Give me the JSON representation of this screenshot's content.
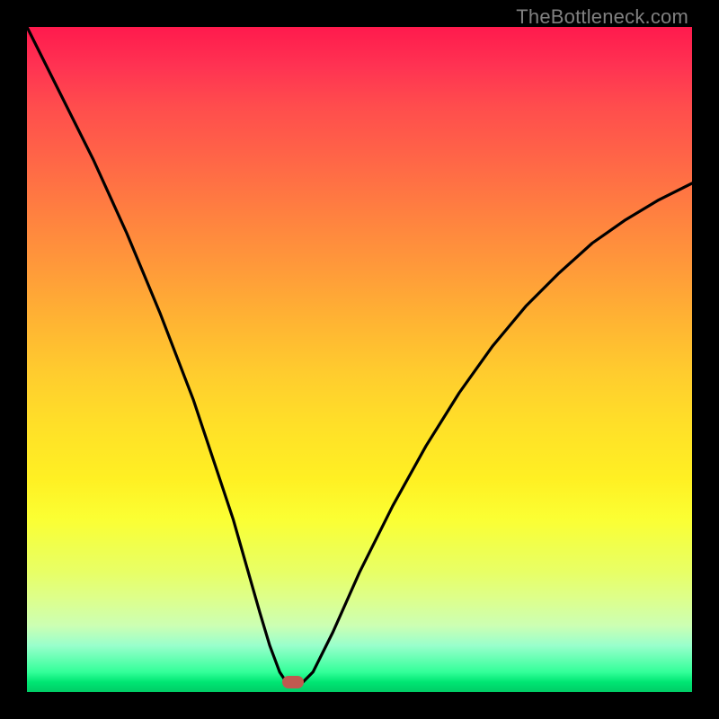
{
  "watermark": "TheBottleneck.com",
  "chart_data": {
    "type": "line",
    "title": "",
    "xlabel": "",
    "ylabel": "",
    "xlim": [
      0,
      100
    ],
    "ylim": [
      0,
      100
    ],
    "series": [
      {
        "name": "bottleneck-curve",
        "x": [
          0,
          5,
          10,
          15,
          20,
          25,
          28,
          31,
          33,
          35,
          36.5,
          38,
          39,
          40,
          41.5,
          43,
          46,
          50,
          55,
          60,
          65,
          70,
          75,
          80,
          85,
          90,
          95,
          100
        ],
        "y": [
          100,
          90,
          80,
          69,
          57,
          44,
          35,
          26,
          19,
          12,
          7,
          3,
          1.5,
          1.5,
          1.5,
          3,
          9,
          18,
          28,
          37,
          45,
          52,
          58,
          63,
          67.5,
          71,
          74,
          76.5
        ]
      }
    ],
    "marker": {
      "x": 40,
      "y": 1.5
    },
    "gradient_stops": [
      {
        "pct": 0,
        "color": "#ff1a4d"
      },
      {
        "pct": 50,
        "color": "#ffcc2e"
      },
      {
        "pct": 80,
        "color": "#f0ff4d"
      },
      {
        "pct": 100,
        "color": "#00cc66"
      }
    ]
  }
}
